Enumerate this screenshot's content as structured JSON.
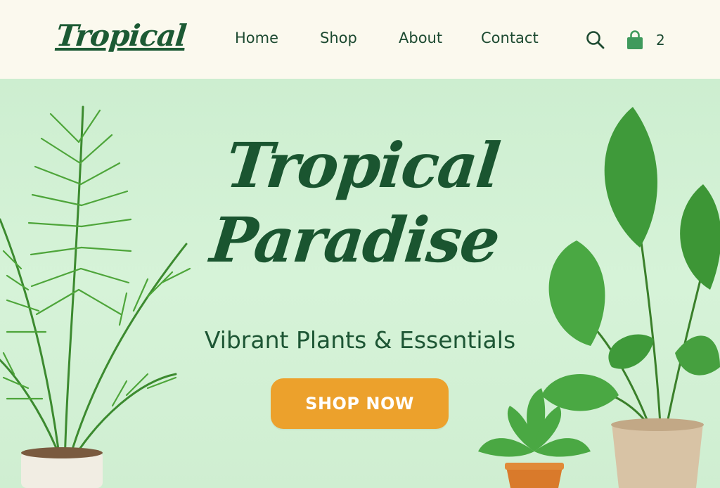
{
  "brand": {
    "logo_text": "Tropical"
  },
  "nav": {
    "items": [
      {
        "label": "Home"
      },
      {
        "label": "Shop"
      },
      {
        "label": "About"
      },
      {
        "label": "Contact"
      }
    ]
  },
  "header_actions": {
    "search_icon": "search-icon",
    "cart_icon": "shopping-bag-icon",
    "cart_count": "2"
  },
  "hero": {
    "title_line1": "Tropical",
    "title_line2": "Paradise",
    "subtitle": "Vibrant Plants & Essentials",
    "cta_label": "SHOP NOW"
  },
  "colors": {
    "header_bg": "#fbf9ee",
    "hero_bg": "#d4f0d6",
    "brand_green": "#1c5a34",
    "cta_orange": "#eca12c",
    "cta_text": "#ffffff"
  }
}
